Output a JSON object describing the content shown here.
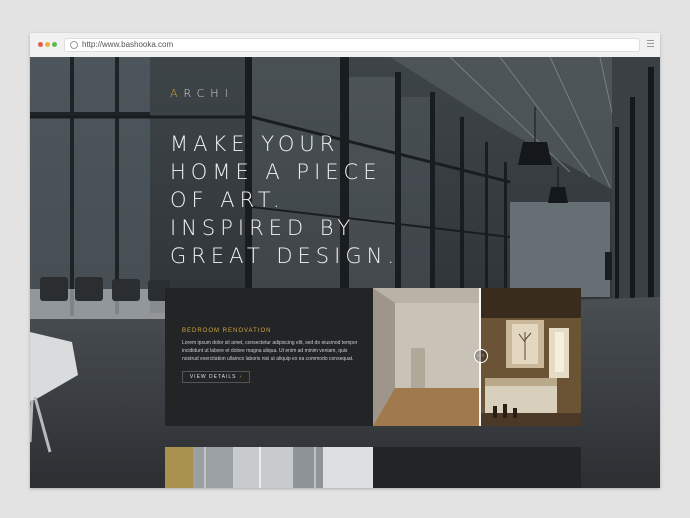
{
  "browser": {
    "url": "http://www.bashooka.com"
  },
  "site": {
    "logo": {
      "first_letter": "A",
      "rest": "RCHI"
    },
    "headline": [
      "MAKE YOUR",
      "HOME A PIECE",
      "OF ART.",
      "INSPIRED BY",
      "GREAT DESIGN."
    ],
    "card": {
      "kicker": "BEDROOM RENOVATION",
      "text": "Lorem ipsum dolor sit amet, consectetur adipiscing elit, sed do eiusmod tempor incididunt ut labore et dolore magna aliqua. Ut enim ad minim veniam, quis nostrud exercitation ullamco laboris nisi ut aliquip ex ea commodo consequat.",
      "button_label": "VIEW DETAILS",
      "button_arrow": "›"
    },
    "compare_handle": {
      "left": "‹",
      "right": "›"
    }
  },
  "colors": {
    "accent": "#d5a640",
    "background": "#2b2f33",
    "card": "#222426"
  }
}
